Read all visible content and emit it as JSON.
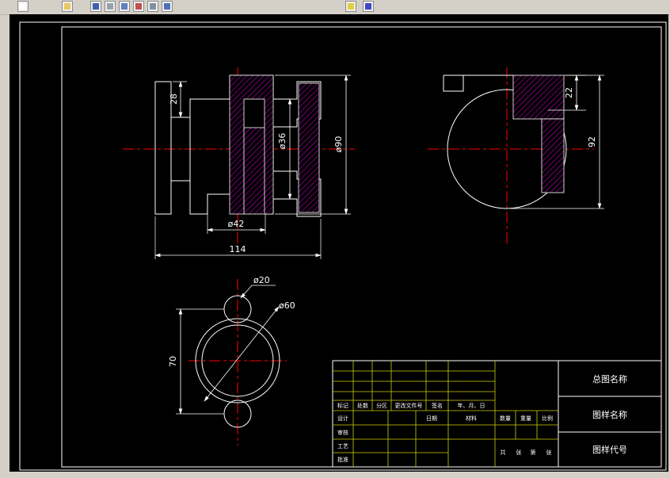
{
  "app": {
    "toolbar_icons": [
      "new-icon",
      "open-icon",
      "save-icon",
      "print-icon",
      "preview-icon",
      "spell-icon",
      "cut-icon",
      "copy-icon",
      "zoom-window-icon",
      "pan-icon"
    ]
  },
  "colors": {
    "canvas": "#000000",
    "outline": "#ffffff",
    "hatch": "#bb00bb",
    "centerline": "#ff0000",
    "table_grid": "#cfcf00",
    "chrome": "#d4d0c8"
  },
  "dims": {
    "front": {
      "h28": "28",
      "d36": "ø36",
      "d90": "ø90",
      "d42": "ø42",
      "w114": "114"
    },
    "side": {
      "h22": "22",
      "h92": "92"
    },
    "bottom": {
      "d20": "ø20",
      "d60": "ø60",
      "h70": "70"
    }
  },
  "title_block": {
    "assembly_name": "总图名称",
    "part_name": "图样名称",
    "part_code": "图样代号",
    "rev_header": [
      "标记",
      "处数",
      "分区",
      "更改文件号",
      "签名",
      "年、月、日"
    ],
    "sign_rows": [
      "设计",
      "审核",
      "工艺",
      "批准"
    ],
    "date_label": "日期",
    "material_label": "材料",
    "qty_label": "数量",
    "weight_label": "重量",
    "scale_label": "比例",
    "sheets_total_label": "共",
    "sheets_unit1": "张",
    "sheets_no_label": "第",
    "sheets_unit2": "张"
  }
}
